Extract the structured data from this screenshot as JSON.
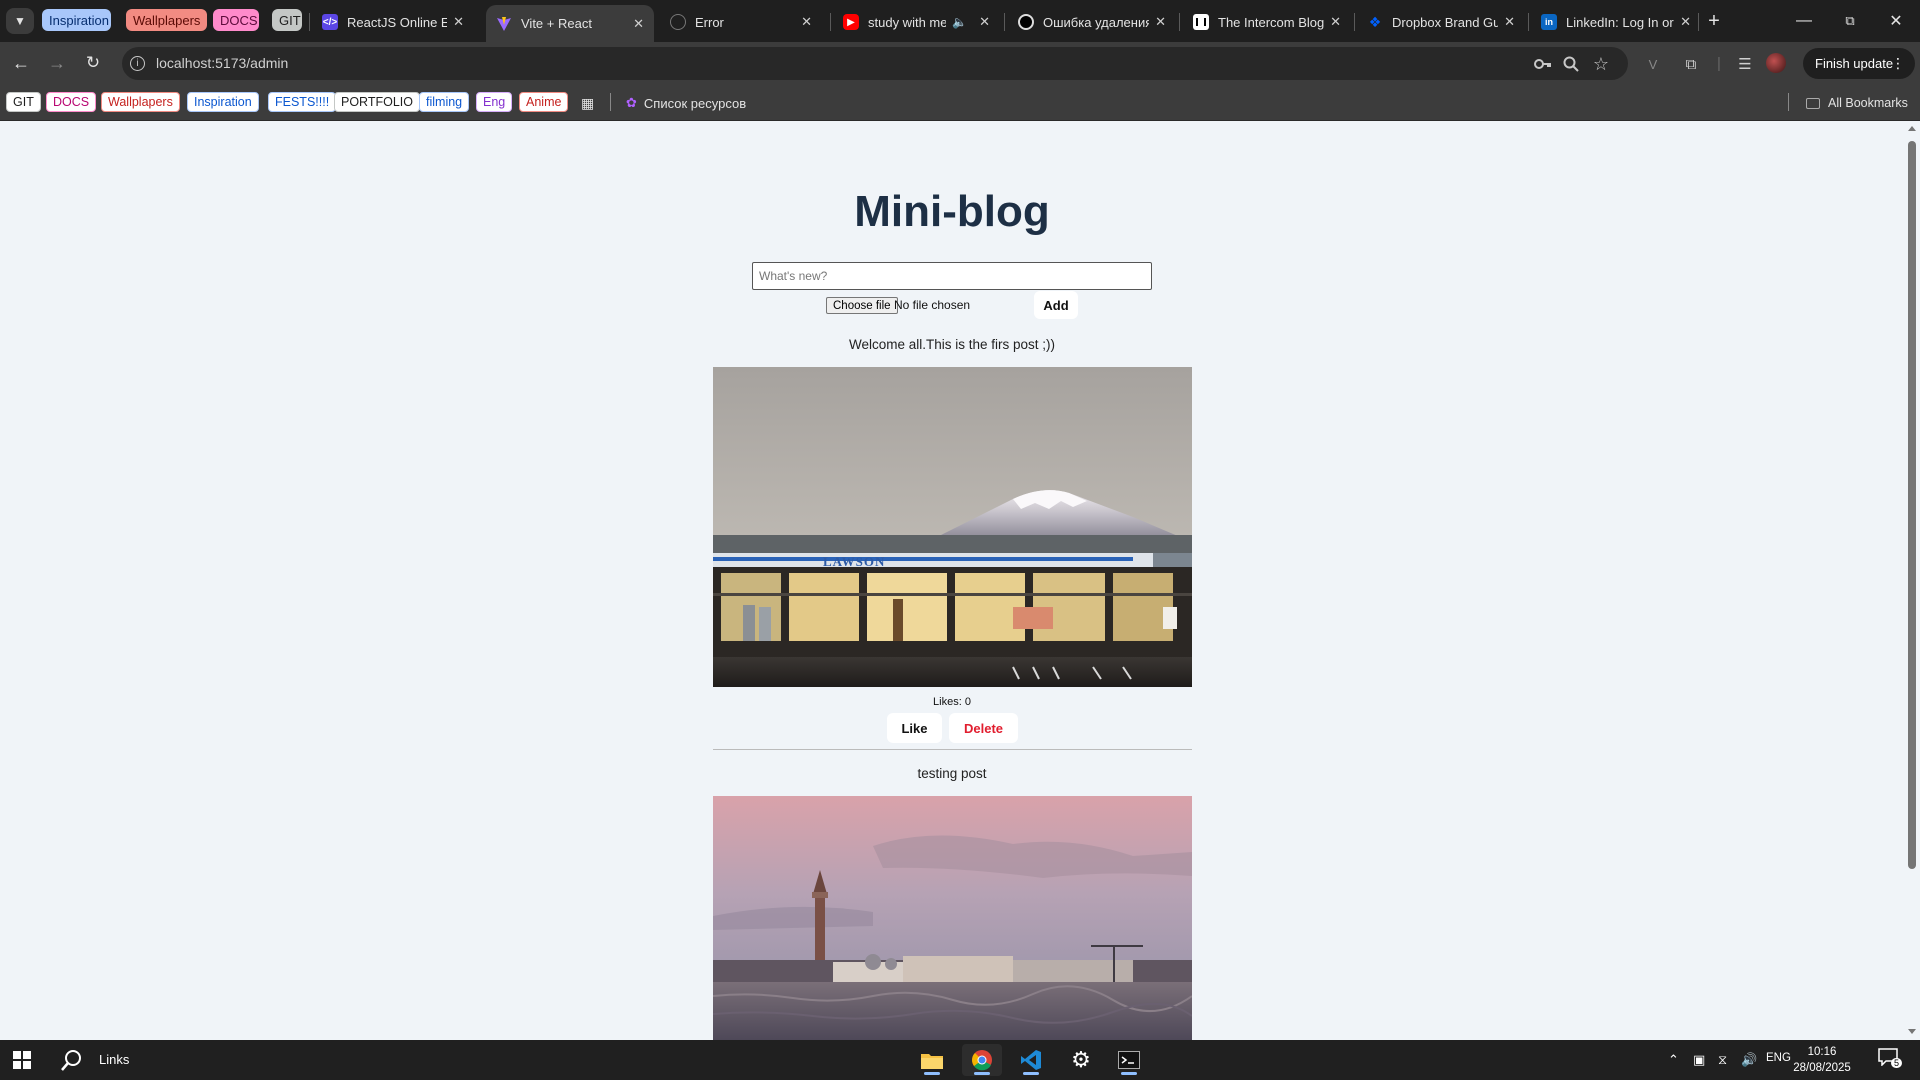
{
  "browser": {
    "tab_groups": [
      {
        "label": "Inspiration",
        "bg": "#a8c7fa",
        "fg": "#062e6f"
      },
      {
        "label": "Wallplapers",
        "bg": "#f28b82",
        "fg": "#5c0b06"
      },
      {
        "label": "DOCS",
        "bg": "#ff8bcb",
        "fg": "#5d0b3b"
      },
      {
        "label": "GIT",
        "bg": "#c4c7c5",
        "fg": "#1f1f1f"
      }
    ],
    "tabs": [
      {
        "title": "ReactJS Online Edit",
        "icon": "code-icon"
      },
      {
        "title": "Vite + React",
        "icon": "vite-icon"
      },
      {
        "title": "Error",
        "icon": "globe-icon"
      },
      {
        "title": "study with me l",
        "icon": "youtube-icon",
        "audio": "speaker-icon"
      },
      {
        "title": "Ошибка удаления",
        "icon": "github-icon"
      },
      {
        "title": "The Intercom Blog",
        "icon": "intercom-icon"
      },
      {
        "title": "Dropbox Brand Gu",
        "icon": "dropbox-icon"
      },
      {
        "title": "LinkedIn: Log In or",
        "icon": "linkedin-icon"
      }
    ],
    "url": "localhost:5173/admin",
    "finish_update": "Finish update",
    "bookmarks": [
      {
        "label": "GIT",
        "bg": "#ffffff",
        "fg": "#1f1f1f",
        "border": "#c4c7c5"
      },
      {
        "label": "DOCS",
        "bg": "#ffffff",
        "fg": "#b80672",
        "border": "#ff8bcb"
      },
      {
        "label": "Wallplapers",
        "bg": "#ffffff",
        "fg": "#c5221f",
        "border": "#f28b82"
      },
      {
        "label": "Inspiration",
        "bg": "#ffffff",
        "fg": "#0b57d0",
        "border": "#a8c7fa"
      },
      {
        "label": "FESTS!!!!",
        "bg": "#ffffff",
        "fg": "#0b57d0",
        "border": "#a8c7fa"
      },
      {
        "label": "PORTFOLIO",
        "bg": "#ffffff",
        "fg": "#1f1f1f",
        "border": "#c4c7c5"
      },
      {
        "label": "filming",
        "bg": "#ffffff",
        "fg": "#0b57d0",
        "border": "#a8c7fa"
      },
      {
        "label": "Eng",
        "bg": "#ffffff",
        "fg": "#8430ce",
        "border": "#d7aefb"
      },
      {
        "label": "Anime",
        "bg": "#ffffff",
        "fg": "#c5221f",
        "border": "#f28b82"
      }
    ],
    "bookmark_resource_list": "Список ресурсов",
    "all_bookmarks": "All Bookmarks"
  },
  "blog": {
    "title": "Mini-blog",
    "input_placeholder": "What's new?",
    "choose_file": "Choose file",
    "file_status": "No file chosen",
    "add_button": "Add",
    "posts": [
      {
        "text": "Welcome all.This is the firs post ;))",
        "image": "mount-fuji-lawson-photo",
        "likes": "Likes: 0",
        "like_label": "Like",
        "delete_label": "Delete"
      },
      {
        "text": "testing post",
        "image": "venice-campanile-photo"
      }
    ]
  },
  "taskbar": {
    "search_label": "Links",
    "language": "ENG",
    "time": "10:16",
    "date": "28/08/2025",
    "notifications": "5"
  },
  "colors": {
    "page_bg": "#f0f4f8",
    "title": "#1d2f45",
    "delete": "#e11d2e"
  }
}
